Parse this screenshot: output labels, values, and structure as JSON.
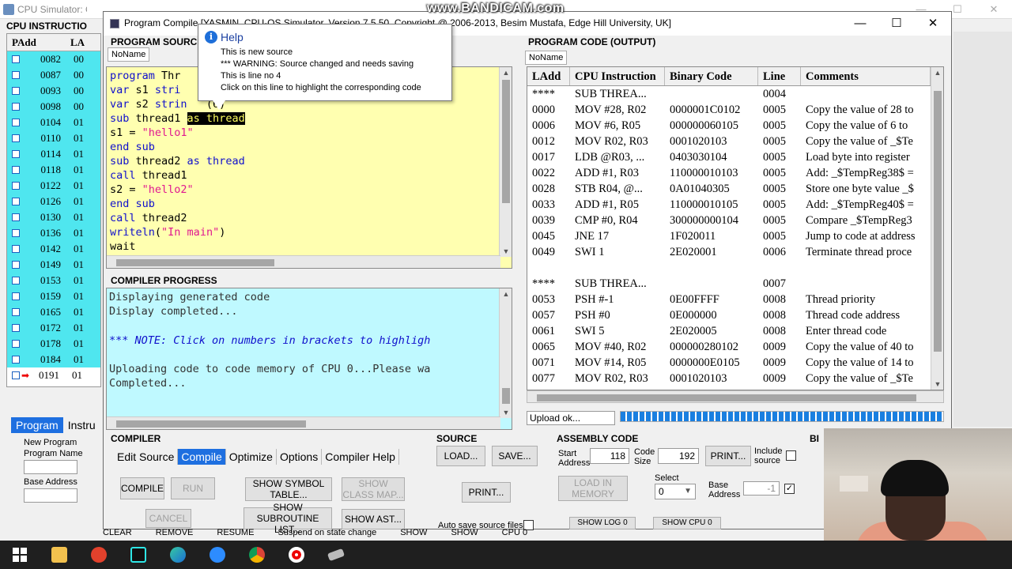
{
  "watermark": "www.BANDICAM.com",
  "background_window": {
    "tab_title": "CPU Simulator: C",
    "instructions_header": "CPU INSTRUCTIO",
    "table_headers": [
      "PAdd",
      "LA"
    ],
    "rows": [
      {
        "addr": "0082",
        "la": "00"
      },
      {
        "addr": "0087",
        "la": "00"
      },
      {
        "addr": "0093",
        "la": "00"
      },
      {
        "addr": "0098",
        "la": "00"
      },
      {
        "addr": "0104",
        "la": "01"
      },
      {
        "addr": "0110",
        "la": "01"
      },
      {
        "addr": "0114",
        "la": "01"
      },
      {
        "addr": "0118",
        "la": "01"
      },
      {
        "addr": "0122",
        "la": "01"
      },
      {
        "addr": "0126",
        "la": "01"
      },
      {
        "addr": "0130",
        "la": "01"
      },
      {
        "addr": "0136",
        "la": "01"
      },
      {
        "addr": "0142",
        "la": "01"
      },
      {
        "addr": "0149",
        "la": "01"
      },
      {
        "addr": "0153",
        "la": "01"
      },
      {
        "addr": "0159",
        "la": "01"
      },
      {
        "addr": "0165",
        "la": "01"
      },
      {
        "addr": "0172",
        "la": "01"
      },
      {
        "addr": "0178",
        "la": "01"
      },
      {
        "addr": "0184",
        "la": "01"
      },
      {
        "addr": "0191",
        "la": "01"
      }
    ],
    "tabs": [
      "Program",
      "Instru"
    ],
    "new_program_label": "New Program",
    "program_name_label": "Program Name",
    "base_address_label": "Base Address",
    "bottom_labels": [
      "CLEAR",
      "REMOVE",
      "RESUME",
      "Suspend on state change",
      "SHOW",
      "SHOW",
      "CPU 0"
    ]
  },
  "compiler_window": {
    "title": "Program Compiler - [YASMIN, CPU-OS Simulator, Version 7.5.50, Copyright @ 2006-2013, Besim Mustafa, Edge Hill University, UK]",
    "title_visible": "Program Compile      [YASMIN, CPU-OS Simulator, Version 7.5.50, Copyright @ 2006-2013, Besim Mustafa, Edge Hill University, UK]",
    "window_buttons": [
      "—",
      "☐",
      "✕"
    ],
    "program_source_label": "PROGRAM SOURC",
    "source_doc_tab": "NoName",
    "source_lines": [
      [
        {
          "t": "program ",
          "c": "kw"
        },
        {
          "t": "Thr",
          "c": ""
        }
      ],
      [
        {
          "t": "var ",
          "c": "kw"
        },
        {
          "t": "s1 ",
          "c": ""
        },
        {
          "t": "stri",
          "c": "kw"
        }
      ],
      [
        {
          "t": "var ",
          "c": "kw"
        },
        {
          "t": "s2 ",
          "c": ""
        },
        {
          "t": "strin",
          "c": "kw"
        },
        {
          "t": "   (6)",
          "c": ""
        }
      ],
      [
        {
          "t": "sub ",
          "c": "kw"
        },
        {
          "t": "thread1 ",
          "c": ""
        },
        {
          "t": "as thread",
          "c": "hl"
        }
      ],
      [
        {
          "t": "s1 = ",
          "c": ""
        },
        {
          "t": "\"hello1\"",
          "c": "str"
        }
      ],
      [
        {
          "t": "end sub",
          "c": "kw"
        }
      ],
      [
        {
          "t": "sub ",
          "c": "kw"
        },
        {
          "t": "thread2 ",
          "c": ""
        },
        {
          "t": "as thread",
          "c": "kw"
        }
      ],
      [
        {
          "t": "call ",
          "c": "kw"
        },
        {
          "t": "thread1",
          "c": ""
        }
      ],
      [
        {
          "t": "s2 = ",
          "c": ""
        },
        {
          "t": "\"hello2\"",
          "c": "str"
        }
      ],
      [
        {
          "t": "end sub",
          "c": "kw"
        }
      ],
      [
        {
          "t": "call ",
          "c": "kw"
        },
        {
          "t": "thread2",
          "c": ""
        }
      ],
      [
        {
          "t": "writeln",
          "c": "kw"
        },
        {
          "t": "(",
          "c": ""
        },
        {
          "t": "\"In main\"",
          "c": "str"
        },
        {
          "t": ")",
          "c": ""
        }
      ],
      [
        {
          "t": "wait",
          "c": ""
        }
      ]
    ],
    "compiler_progress_label": "COMPILER PROGRESS",
    "progress_lines": [
      {
        "t": "Displaying generated code",
        "c": ""
      },
      {
        "t": "Display completed...",
        "c": ""
      },
      {
        "t": "",
        "c": ""
      },
      {
        "t": "*** NOTE: Click on numbers in brackets to highligh",
        "c": "note"
      },
      {
        "t": "",
        "c": ""
      },
      {
        "t": "Uploading code to code memory of CPU 0...Please wa",
        "c": ""
      },
      {
        "t": "Completed...",
        "c": ""
      }
    ],
    "program_code_label": "PROGRAM CODE (OUTPUT)",
    "output_doc_tab": "NoName",
    "output_headers": [
      "LAdd",
      "CPU Instruction",
      "Binary Code",
      "Line",
      "Comments"
    ],
    "output_rows": [
      [
        "****",
        "SUB THREA...",
        "",
        "0004",
        ""
      ],
      [
        "0000",
        "MOV #28, R02",
        "0000001C0102",
        "0005",
        "Copy the value of  28 to"
      ],
      [
        "0006",
        "MOV #6, R05",
        "000000060105",
        "0005",
        "Copy the value of  6 to"
      ],
      [
        "0012",
        "MOV R02, R03",
        "0001020103",
        "0005",
        "Copy the value of _$Te"
      ],
      [
        "0017",
        "LDB @R03, ...",
        "0403030104",
        "0005",
        "Load byte into register"
      ],
      [
        "0022",
        "ADD #1, R03",
        "110000010103",
        "0005",
        "Add: _$TempReg38$ ="
      ],
      [
        "0028",
        "STB R04, @...",
        "0A01040305",
        "0005",
        "Store one byte value _$"
      ],
      [
        "0033",
        "ADD #1, R05",
        "110000010105",
        "0005",
        "Add: _$TempReg40$ ="
      ],
      [
        "0039",
        "CMP #0, R04",
        "300000000104",
        "0005",
        "Compare _$TempReg3"
      ],
      [
        "0045",
        "JNE 17",
        "1F020011",
        "0005",
        "Jump to code at address"
      ],
      [
        "0049",
        "SWI 1",
        "2E020001",
        "0006",
        "Terminate thread proce"
      ],
      [
        "",
        "",
        "",
        "",
        ""
      ],
      [
        "****",
        "SUB THREA...",
        "",
        "0007",
        ""
      ],
      [
        "0053",
        "PSH #-1",
        "0E00FFFF",
        "0008",
        "Thread priority"
      ],
      [
        "0057",
        "PSH #0",
        "0E000000",
        "0008",
        "Thread code address"
      ],
      [
        "0061",
        "SWI 5",
        "2E020005",
        "0008",
        "Enter thread code"
      ],
      [
        "0065",
        "MOV #40, R02",
        "000000280102",
        "0009",
        "Copy the value of  40 to"
      ],
      [
        "0071",
        "MOV #14, R05",
        "0000000E0105",
        "0009",
        "Copy the value of  14 to"
      ],
      [
        "0077",
        "MOV R02, R03",
        "0001020103",
        "0009",
        "Copy the value of _$Te"
      ]
    ],
    "upload_status": "Upload ok...",
    "upload_progress": 1.0
  },
  "help_tooltip": {
    "title": "Help",
    "lines": [
      "This is new source",
      "*** WARNING: Source changed and needs saving",
      "This is line no 4",
      "Click on this line to highlight the corresponding code"
    ]
  },
  "compiler_section": {
    "label": "COMPILER",
    "tabs": [
      "Edit Source",
      "Compile",
      "Optimize",
      "Options",
      "Compiler Help"
    ],
    "active_tab": "Compile",
    "buttons": {
      "compile": "COMPILE",
      "run": "RUN",
      "cancel": "CANCEL",
      "show_symbol_table": "SHOW SYMBOL TABLE...",
      "show_class_map": "SHOW CLASS MAP...",
      "show_subroutine_list": "SHOW SUBROUTINE LIST...",
      "show_ast": "SHOW AST..."
    }
  },
  "source_section": {
    "label": "SOURCE",
    "load": "LOAD...",
    "save": "SAVE...",
    "print": "PRINT...",
    "auto_save": "Auto save source files"
  },
  "assembly_section": {
    "label": "ASSEMBLY CODE",
    "start_address_label": "Start Address",
    "start_address": "118",
    "code_size_label": "Code Size",
    "code_size": "192",
    "print": "PRINT...",
    "include_source": "Include source",
    "load_in_memory": "LOAD IN MEMORY",
    "select_label": "Select",
    "select_value": "0",
    "base_address_label": "Base Address",
    "base_address": "-1",
    "show_buttons": [
      "SHOW LOG 0",
      "SHOW CPU 0",
      "SHOW"
    ]
  },
  "bin_label": "BI",
  "taskbar": {
    "icons": [
      "windows-start-icon",
      "file-explorer-icon",
      "app-red-icon",
      "tiktok-icon",
      "edge-icon",
      "zoom-icon",
      "chrome-icon",
      "record-icon",
      "cpu-sim-icon"
    ]
  }
}
